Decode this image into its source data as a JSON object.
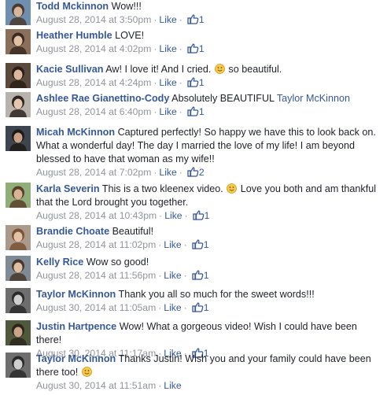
{
  "ui": {
    "like_label": "Like",
    "separator": "·"
  },
  "comments": [
    {
      "author": "Todd Mckinnon",
      "text": "Wow!!!",
      "time": "August 28, 2014 at 3:50pm",
      "like_count": "1",
      "avatar": {
        "bg": "#6f8fb0",
        "skin": "#d9b59a",
        "hair": "#4a3a2e"
      }
    },
    {
      "author": "Heather Humble",
      "text": "LOVE!",
      "time": "August 28, 2014 at 4:02pm",
      "like_count": "1",
      "avatar": {
        "bg": "#8a6f5a",
        "skin": "#e2c0a6",
        "hair": "#3b2a20"
      }
    },
    {
      "author": "Kacie Sullivan",
      "text": "Aw! I love it! And I cried.",
      "text_tail": "so beautiful.",
      "time": "August 28, 2014 at 4:24pm",
      "like_count": "1",
      "avatar": {
        "bg": "#5a4a3e",
        "skin": "#dcb79d",
        "hair": "#2a1d15"
      }
    },
    {
      "author": "Ashlee Rae Gianettino-Cody",
      "text": "Absolutely BEAUTIFUL",
      "mention": "Taylor McKinnon",
      "time": "August 28, 2014 at 6:40pm",
      "like_count": "1",
      "avatar": {
        "bg": "#b8b2ac",
        "skin": "#e6c7ae",
        "hair": "#2b2420"
      }
    },
    {
      "author": "Micah McKinnon",
      "text": "Captured perfectly! So happy we have this to look back on. What a wonderful day! The day I married the love of my life! I am beyond blessed to have that woman as my wife!!",
      "time": "August 28, 2014 at 7:02pm",
      "like_count": "2",
      "avatar": {
        "bg": "#3d4650",
        "skin": "#c9a287",
        "hair": "#1e1a18"
      }
    },
    {
      "author": "Karla Severin",
      "text": "This is a two kleenex video.",
      "text_tail": "Love you both and am thankful that the Lord brought you together.",
      "time": "August 28, 2014 at 10:43pm",
      "like_count": "1",
      "avatar": {
        "bg": "#8fae7a",
        "skin": "#d8b395",
        "hair": "#5a3e28"
      }
    },
    {
      "author": "Brandie Choate",
      "text": "Beautiful!",
      "time": "August 28, 2014 at 11:02pm",
      "like_count": "1",
      "avatar": {
        "bg": "#a99a8c",
        "skin": "#e4c2a8",
        "hair": "#7a5236"
      }
    },
    {
      "author": "Kelly Rice",
      "text": "Wow so good!",
      "time": "August 28, 2014 at 11:56pm",
      "like_count": "1",
      "avatar": {
        "bg": "#7e8a96",
        "skin": "#dfbea4",
        "hair": "#4a3628"
      }
    },
    {
      "author": "Taylor McKinnon",
      "text": "Thank you all so much for the sweet words!!!",
      "time": "August 30, 2014 at 11:05am",
      "like_count": "1",
      "avatar": {
        "bg": "#6e6e6e",
        "skin": "#cfcfcf",
        "hair": "#2a2a2a"
      }
    },
    {
      "author": "Justin Hartpence",
      "text": "Wow! What a gorgeous video! Wish I could have been there!",
      "time": "August 30, 2014 at 11:17am",
      "like_count": "1",
      "avatar": {
        "bg": "#4f5a3c",
        "skin": "#c8a488",
        "hair": "#2e241c"
      }
    },
    {
      "author": "Taylor McKinnon",
      "text": "Thanks Justin! Wish you and your family could have been there too!",
      "text_tail": "",
      "time": "August 30, 2014 at 11:51am",
      "like_count": "",
      "avatar": {
        "bg": "#6e6e6e",
        "skin": "#cfcfcf",
        "hair": "#2a2a2a"
      }
    }
  ],
  "colors": {
    "link": "#365899",
    "meta": "#90949c",
    "text": "#1d2129",
    "smiley": "#f7c948"
  }
}
